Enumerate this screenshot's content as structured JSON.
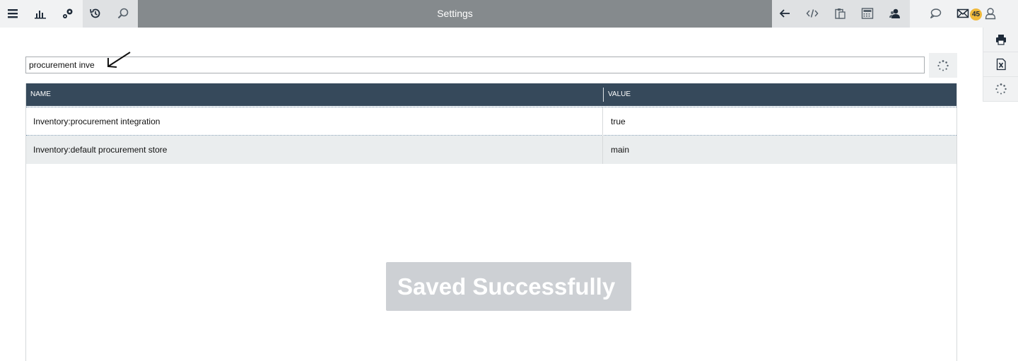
{
  "header": {
    "title": "Settings",
    "left_icons": [
      "menu-icon",
      "bar-chart-icon",
      "settings-gears-icon",
      "history-icon",
      "search-icon"
    ],
    "right_icons": [
      "back-arrow-icon",
      "code-icon",
      "clipboard-icon",
      "calculator-icon",
      "user-group-icon",
      "chat-icon",
      "mail-icon",
      "user-icon"
    ],
    "mail_count": "45"
  },
  "side_toolbar": {
    "icons": [
      "print-icon",
      "excel-export-icon",
      "refresh-icon"
    ]
  },
  "search": {
    "value": "procurement inve"
  },
  "table": {
    "columns": [
      "NAME",
      "VALUE"
    ],
    "rows": [
      {
        "name": "Inventory:procurement integration",
        "value": "true"
      },
      {
        "name": "Inventory:default procurement store",
        "value": "main"
      }
    ]
  },
  "toast": {
    "message": "Saved Successfully"
  },
  "colors": {
    "header_bar": "#858a8d",
    "grid_header": "#36495b",
    "badge": "#f0b93a"
  }
}
